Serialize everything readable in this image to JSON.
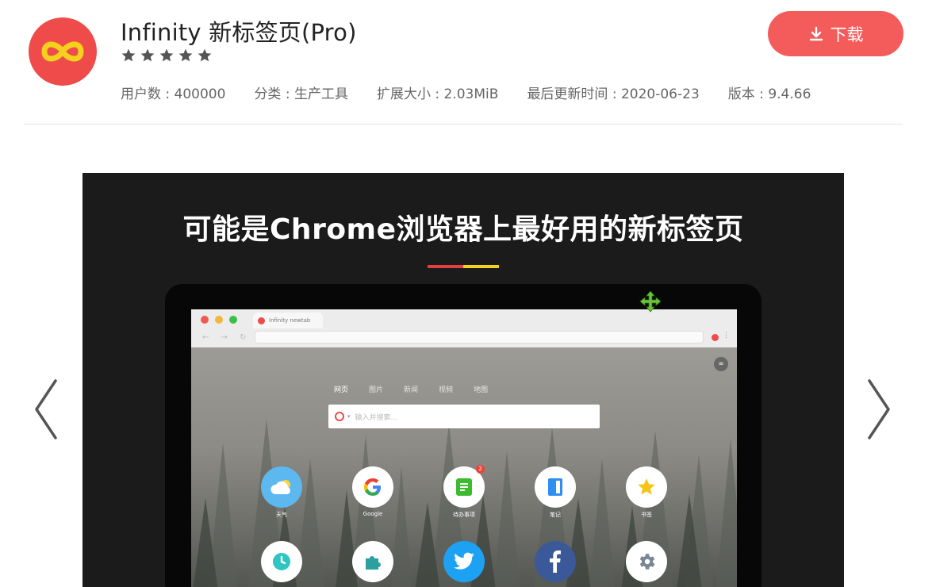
{
  "app": {
    "title": "Infinity 新标签页(Pro)",
    "rating": 5,
    "meta": [
      "用户数 : 400000",
      "分类 : 生产工具",
      "扩展大小 : 2.03MiB",
      "最后更新时间 : 2020-06-23",
      "版本 : 9.4.66"
    ],
    "download_label": "下载"
  },
  "slide": {
    "heading": "可能是Chrome浏览器上最好用的新标签页",
    "browser_tab": "Infinity newtab",
    "search_tabs": [
      "网页",
      "图片",
      "新闻",
      "视频",
      "地图"
    ],
    "search_placeholder": "输入并搜索...",
    "apps_row1": [
      {
        "icon": "weather-icon",
        "label": "天气"
      },
      {
        "icon": "google-icon",
        "label": "Google"
      },
      {
        "icon": "todo-icon",
        "label": "待办事项",
        "badge": "2"
      },
      {
        "icon": "notes-icon",
        "label": "笔记"
      },
      {
        "icon": "bookmark-star-icon",
        "label": "书签"
      }
    ],
    "apps_row2": [
      {
        "icon": "clock-icon"
      },
      {
        "icon": "puzzle-icon"
      },
      {
        "icon": "twitter-icon"
      },
      {
        "icon": "facebook-icon"
      },
      {
        "icon": "settings-gear-icon"
      }
    ]
  },
  "colors": {
    "brand": "#ef4b4b",
    "download_button": "#f45c5c",
    "slide_background": "#1b1b1b",
    "accent_red": "#e3403d",
    "accent_yellow": "#f4d11d"
  }
}
